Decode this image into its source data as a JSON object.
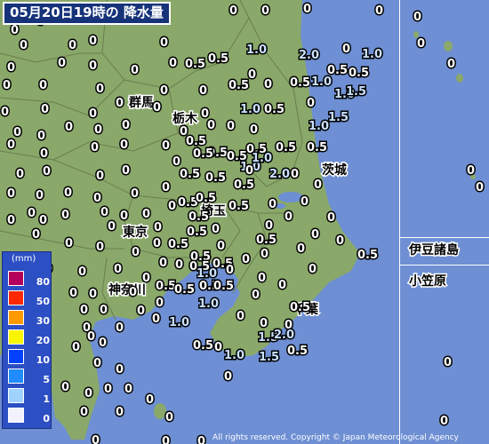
{
  "title": "05月20日19時の 降水量",
  "copyright": "All rights reserved. Copyright © Japan Meteorological Agency",
  "legend": {
    "unit": "(mm)",
    "items": [
      {
        "label": "80",
        "color": "#b4005a"
      },
      {
        "label": "50",
        "color": "#ff2800"
      },
      {
        "label": "30",
        "color": "#ff9900"
      },
      {
        "label": "20",
        "color": "#faf500"
      },
      {
        "label": "10",
        "color": "#0041ff"
      },
      {
        "label": "5",
        "color": "#218cff"
      },
      {
        "label": "1",
        "color": "#a0d2ff"
      },
      {
        "label": "0",
        "color": "#f2f2ff"
      }
    ]
  },
  "places": [
    "群馬",
    "栃木",
    "茨城",
    "埼玉",
    "東京",
    "神奈川",
    "千葉",
    "伊豆諸島",
    "小笠原"
  ],
  "colors": {
    "land": "#8aa86a",
    "sea": "#6e8fd3",
    "border": "#6b7f4f",
    "panel": "#16337a"
  }
}
